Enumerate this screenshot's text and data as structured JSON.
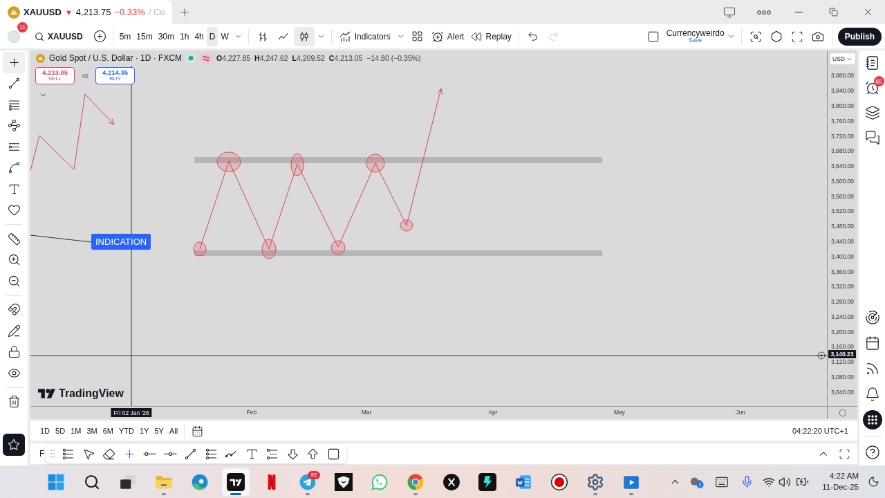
{
  "title_bar": {
    "tab": {
      "symbol": "XAUUSD",
      "arrow": "▼",
      "price": "4,213.75",
      "change": "−0.33%",
      "more": "/ Cu"
    }
  },
  "toolbar": {
    "notifications": "11",
    "symbol": "XAUUSD",
    "intervals": [
      {
        "label": "5m",
        "selected": false
      },
      {
        "label": "15m",
        "selected": false
      },
      {
        "label": "30m",
        "selected": false
      },
      {
        "label": "1h",
        "selected": false
      },
      {
        "label": "4h",
        "selected": false
      },
      {
        "label": "D",
        "selected": true
      },
      {
        "label": "W",
        "selected": false
      }
    ],
    "chart_types": [
      {
        "kind": "bars",
        "selected": false
      },
      {
        "kind": "line",
        "selected": false
      },
      {
        "kind": "candles",
        "selected": true
      }
    ],
    "indicators": "Indicators",
    "alert": "Alert",
    "replay": "Replay",
    "undo": {
      "disabled": false
    },
    "redo": {
      "disabled": true
    },
    "layout": {
      "name": "Currencyweirdo",
      "save": "Save"
    },
    "publish": "Publish"
  },
  "left_toolbar": {
    "groups": [
      {
        "tools": [
          {
            "kind": "crosshair",
            "selected": true
          },
          {
            "kind": "trend-line",
            "selected": false
          },
          {
            "kind": "fib",
            "selected": false
          },
          {
            "kind": "pattern",
            "selected": false
          },
          {
            "kind": "projection",
            "selected": false
          },
          {
            "kind": "brush",
            "selected": false
          },
          {
            "kind": "text",
            "selected": false
          },
          {
            "kind": "heart",
            "selected": false
          }
        ]
      },
      {
        "tools": [
          {
            "kind": "ruler",
            "selected": false
          },
          {
            "kind": "zoom-in",
            "selected": false
          },
          {
            "kind": "zoom-out",
            "selected": false
          }
        ]
      },
      {
        "tools": [
          {
            "kind": "magnet",
            "selected": false
          },
          {
            "kind": "pencil-lock",
            "selected": false
          },
          {
            "kind": "lock",
            "selected": false
          },
          {
            "kind": "eye",
            "selected": false
          }
        ]
      },
      {
        "tools": [
          {
            "kind": "trash",
            "selected": false
          }
        ]
      }
    ]
  },
  "chart": {
    "title": "Gold Spot / U.S. Dollar · 1D · FXCM",
    "ohlc": [
      {
        "key": "O",
        "value": "4,227.85"
      },
      {
        "key": "H",
        "value": "4,247.62"
      },
      {
        "key": "L",
        "value": "4,209.52"
      },
      {
        "key": "C",
        "value": "4,213.05"
      }
    ],
    "change": "−14.80 (−0.35%)",
    "sell": {
      "price": "4,213.95",
      "label": "SELL"
    },
    "spread": "40",
    "buy": {
      "price": "4,214.35",
      "label": "BUY"
    },
    "annotation": "INDICATION",
    "logo": "TradingView"
  },
  "price_axis": {
    "currency": "USD",
    "labels": [
      "3,880.00",
      "3,840.00",
      "3,800.00",
      "3,760.00",
      "3,720.00",
      "3,680.00",
      "3,640.00",
      "3,600.00",
      "3,560.00",
      "3,520.00",
      "3,480.00",
      "3,440.00",
      "3,400.00",
      "3,360.00",
      "3,320.00",
      "3,280.00",
      "3,240.00",
      "3,200.00",
      "3,160.00",
      "3,120.00",
      "3,080.00",
      "3,040.00"
    ],
    "crosshair_price": "3,140.23"
  },
  "time_axis": {
    "crosshair_date": "Fri 02 Jan '26",
    "labels": [
      "Feb",
      "Mar",
      "Apr",
      "May",
      "Jun"
    ]
  },
  "range_bar": {
    "ranges": [
      "1D",
      "5D",
      "1M",
      "3M",
      "6M",
      "YTD",
      "1Y",
      "5Y",
      "All"
    ],
    "clock": "04:22:20 UTC+1"
  },
  "drawing_toolbar": {
    "label": "F",
    "tools": [
      {
        "kind": "fib-lines",
        "selected": false
      },
      {
        "kind": "cursor",
        "selected": false
      },
      {
        "kind": "eraser",
        "selected": false
      },
      {
        "kind": "crosshair",
        "selected": true
      },
      {
        "kind": "ray",
        "selected": false
      },
      {
        "kind": "segment",
        "selected": false
      },
      {
        "kind": "trend-line",
        "selected": false
      },
      {
        "kind": "lines",
        "selected": false
      },
      {
        "kind": "path",
        "selected": false
      },
      {
        "kind": "text",
        "selected": false
      },
      {
        "kind": "channel",
        "selected": false
      },
      {
        "kind": "arrow-down",
        "selected": false
      },
      {
        "kind": "arrow-up",
        "selected": false
      },
      {
        "kind": "rectangle",
        "selected": false
      }
    ]
  },
  "right_sidebar": {
    "top": [
      {
        "kind": "watchlist"
      },
      {
        "kind": "alerts",
        "badge": "65"
      },
      {
        "kind": "layers"
      },
      {
        "kind": "chat"
      }
    ],
    "bottom": [
      {
        "kind": "radar"
      },
      {
        "kind": "calendar"
      },
      {
        "kind": "broadcast"
      },
      {
        "kind": "bell"
      },
      {
        "kind": "products"
      },
      {
        "kind": "help"
      }
    ]
  },
  "taskbar": {
    "apps": [
      {
        "kind": "start",
        "selected": false,
        "running": false
      },
      {
        "kind": "search",
        "selected": false,
        "running": false
      },
      {
        "kind": "task-view",
        "selected": false,
        "running": false
      },
      {
        "kind": "folder",
        "selected": false,
        "running": true
      },
      {
        "kind": "swirl",
        "selected": false,
        "running": false
      },
      {
        "kind": "chart-app",
        "selected": true,
        "running": true
      },
      {
        "kind": "ribbon",
        "selected": false,
        "running": false
      },
      {
        "kind": "plane",
        "selected": false,
        "running": true,
        "badge": "92"
      },
      {
        "kind": "bird",
        "selected": false,
        "running": false
      },
      {
        "kind": "phone",
        "selected": false,
        "running": false
      },
      {
        "kind": "browser",
        "selected": false,
        "running": true
      },
      {
        "kind": "x",
        "selected": false,
        "running": false
      },
      {
        "kind": "bolt",
        "selected": false,
        "running": false
      },
      {
        "kind": "document",
        "selected": false,
        "running": false
      },
      {
        "kind": "record",
        "selected": false,
        "running": false
      },
      {
        "kind": "gear",
        "selected": false,
        "running": true
      },
      {
        "kind": "play",
        "selected": false,
        "running": true
      }
    ],
    "time": "4:22 AM",
    "date": "11-Dec-25"
  }
}
